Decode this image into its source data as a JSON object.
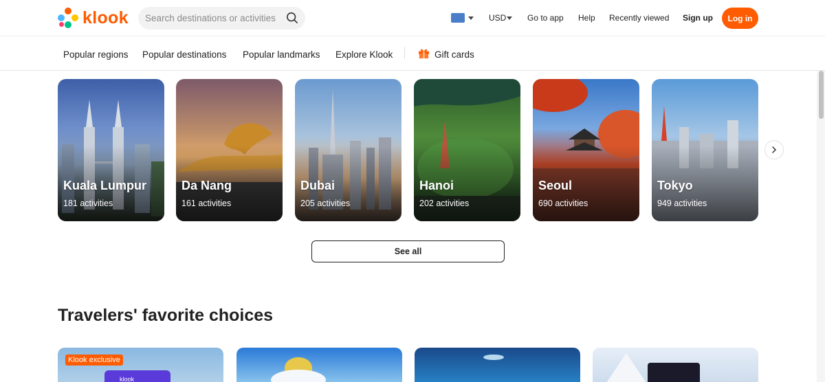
{
  "header": {
    "logo_text": "klook",
    "search_placeholder": "Search destinations or activities",
    "currency": "USD",
    "go_to_app": "Go to app",
    "help": "Help",
    "recently_viewed": "Recently viewed",
    "sign_up": "Sign up",
    "log_in": "Log in"
  },
  "subnav": {
    "items": [
      "Popular regions",
      "Popular destinations",
      "Popular landmarks",
      "Explore Klook"
    ],
    "gift_cards": "Gift cards"
  },
  "destinations": [
    {
      "name": "Kuala Lumpur",
      "count": "181 activities"
    },
    {
      "name": "Da Nang",
      "count": "161 activities"
    },
    {
      "name": "Dubai",
      "count": "205 activities"
    },
    {
      "name": "Hanoi",
      "count": "202 activities"
    },
    {
      "name": "Seoul",
      "count": "690 activities"
    },
    {
      "name": "Tokyo",
      "count": "949 activities"
    }
  ],
  "see_all": "See all",
  "favorites": {
    "title": "Travelers' favorite choices",
    "badge": "Klook exclusive",
    "card_brand": "klook"
  },
  "colors": {
    "accent": "#ff5b00"
  }
}
